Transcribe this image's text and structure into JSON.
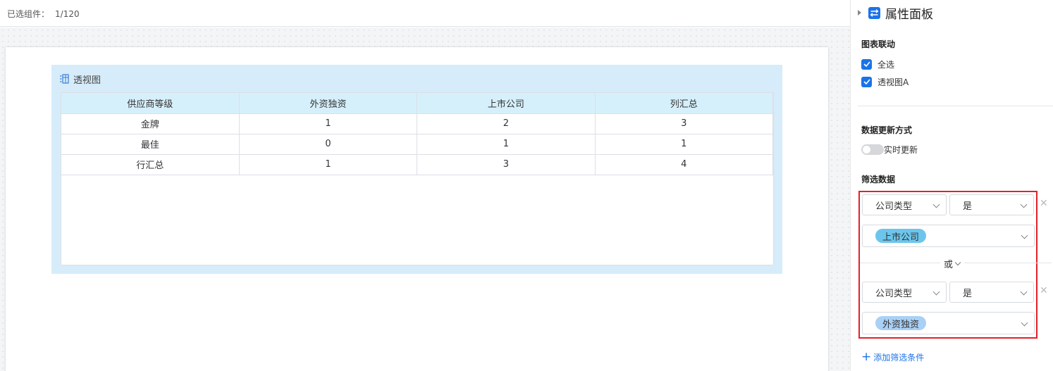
{
  "topbar": {
    "selected_label": "已选组件：",
    "selected_count": "1/120"
  },
  "widget": {
    "title": "透视图",
    "icon": "pivot-table-icon",
    "columns": [
      "供应商等级",
      "外资独资",
      "上市公司",
      "列汇总"
    ],
    "rows": [
      [
        "金牌",
        "1",
        "2",
        "3"
      ],
      [
        "最佳",
        "0",
        "1",
        "1"
      ],
      [
        "行汇总",
        "1",
        "3",
        "4"
      ]
    ]
  },
  "panel": {
    "title": "属性面板",
    "icon": "sliders-icon",
    "chart_link": {
      "title": "图表联动",
      "options": [
        {
          "label": "全选",
          "checked": true
        },
        {
          "label": "透视图A",
          "checked": true
        }
      ]
    },
    "update_mode": {
      "title": "数据更新方式",
      "toggle_label": "实时更新",
      "enabled": false
    },
    "filter": {
      "title": "筛选数据",
      "conditions": [
        {
          "field": "公司类型",
          "operator": "是",
          "value": "上市公司",
          "tag_color": "#6cc5ec"
        },
        {
          "field": "公司类型",
          "operator": "是",
          "value": "外资独资",
          "tag_color": "#a9d0f5"
        }
      ],
      "join": "或",
      "add_label": "添加筛选条件"
    }
  },
  "colors": {
    "accent": "#1a73e8",
    "highlight_border": "#e4202a",
    "widget_bg": "#d6ecfa",
    "header_bg": "#d6f0fb"
  }
}
